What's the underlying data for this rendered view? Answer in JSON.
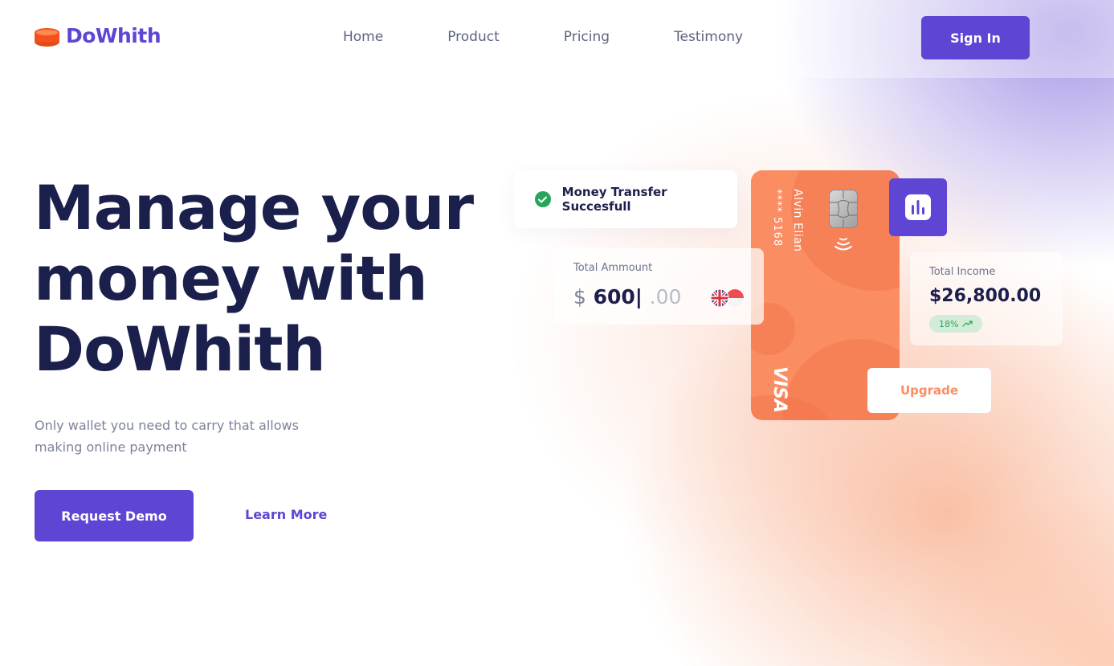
{
  "brand": {
    "name": "DoWhith",
    "icon": "coin-stack-icon"
  },
  "nav": {
    "items": [
      {
        "label": "Home"
      },
      {
        "label": "Product"
      },
      {
        "label": "Pricing"
      },
      {
        "label": "Testimony"
      }
    ],
    "signin_label": "Sign In"
  },
  "hero": {
    "title_lines": [
      "Manage your",
      "money with",
      "DoWhith"
    ],
    "subtitle_lines": [
      "Only wallet you need to carry that allows",
      "making online payment"
    ],
    "primary_cta": "Request Demo",
    "secondary_cta": "Learn More"
  },
  "transfer_card": {
    "icon": "check-circle-icon",
    "text": "Money Transfer Succesfull"
  },
  "visa_card": {
    "holder": "Alvin Elian",
    "number": "**** 5168",
    "brand": "VISA"
  },
  "stats_button": {
    "icon": "bar-chart-icon"
  },
  "amount_card": {
    "label": "Total Ammount",
    "currency": "$",
    "value": "600|",
    "decimals": ".00",
    "flags": [
      "uk-flag-icon",
      "singapore-flag-icon"
    ]
  },
  "income_card": {
    "label": "Total Income",
    "value": "$26,800.00",
    "change": "18%",
    "trend_icon": "trending-up-icon"
  },
  "upgrade_label": "Upgrade",
  "colors": {
    "accent": "#5f45d4",
    "orange": "#fb8d62",
    "navy": "#1b1f4b",
    "success": "#26a65b"
  }
}
